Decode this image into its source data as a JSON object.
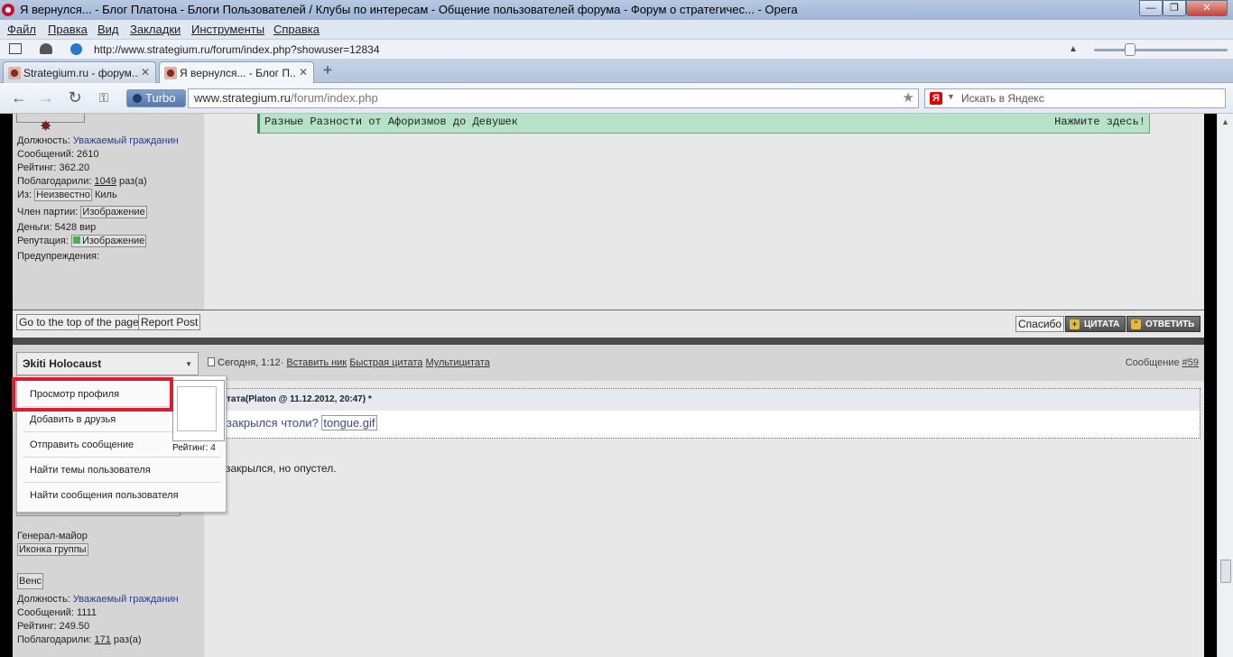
{
  "window": {
    "title": "Я вернулся... - Блог Платона - Блоги Пользователей / Клубы по интересам - Общение пользователей форума - Форум о стратегичес... - Opera",
    "min": "—",
    "max": "❐",
    "close": "✕"
  },
  "menu": [
    "Файл",
    "Правка",
    "Вид",
    "Закладки",
    "Инструменты",
    "Справка"
  ],
  "infobar": {
    "url": "http://www.strategium.ru/forum/index.php?showuser=12834"
  },
  "tabs": [
    {
      "label": "Strategium.ru - форум...",
      "close": "✕"
    },
    {
      "label": "Я вернулся... - Блог П...",
      "close": "✕"
    }
  ],
  "new_tab": "+",
  "nav": {
    "turbo": "Turbo",
    "address_host": "www.strategium.ru",
    "address_path": "/forum/index.php",
    "search_placeholder": "Искать в Яндекс",
    "ya": "Я"
  },
  "ad_bar": {
    "left": "Разные Разности от Афоризмов до Девушек",
    "right": "Нажмите здесь!"
  },
  "user1": {
    "position_label": "Должность:",
    "position_value": "Уважаемый гражданин",
    "posts": "Сообщений: 2610",
    "rating": "Рейтинг: 362.20",
    "thanks_label": "Поблагодарили:",
    "thanks_value": "1049",
    "thanks_suffix": "раз(а)",
    "from_label": "Из:",
    "from_img": "Неизвестно",
    "from_city": "Киль",
    "party_label": "Член партии:",
    "party_img": "Изображение",
    "money": "Деньги: 5428 вир",
    "rep_label": "Репутация:",
    "rep_img": "Изображение",
    "warnings": "Предупреждения:"
  },
  "actions": {
    "go_top": "Go to the top of the page",
    "report": "Report Post",
    "thanks": "Спасибо",
    "quote": "ЦИТАТА",
    "reply": "ОТВЕТИТЬ"
  },
  "post2": {
    "user": "Эkiti Holocaust",
    "date": "Сегодня, 1:12",
    "insert_nick": "Вставить ник",
    "quick_quote": "Быстрая цитата",
    "multiquote": "Мультицитата",
    "post_label": "Сообщение",
    "post_num": "#59",
    "quote_head": "тата(Platon @ 11.12.2012, 20:47)",
    "quote_mark": "*",
    "quote_text": "закрылся чтоли?",
    "quote_img": "tongue.gif",
    "reply": "закрылся, но опустел."
  },
  "user2": {
    "rank": "Генерал-майор",
    "group_icon": "Иконка группы",
    "flag": "Венс",
    "position_label": "Должность:",
    "position_value": "Уважаемый гражданин",
    "posts": "Сообщений: 1111",
    "rating": "Рейтинг: 249.50",
    "thanks_label": "Поблагодарили:",
    "thanks_value": "171",
    "thanks_suffix": "раз(а)"
  },
  "popup": {
    "items": [
      "Просмотр профиля",
      "Добавить в друзья",
      "Отправить сообщение",
      "Найти темы пользователя",
      "Найти сообщения пользователя"
    ],
    "rating": "Рейтинг: 4"
  },
  "colors": {
    "highlight": "#e01b2b",
    "ad_bg": "#b6e2c7",
    "link": "#2b3b8f"
  }
}
